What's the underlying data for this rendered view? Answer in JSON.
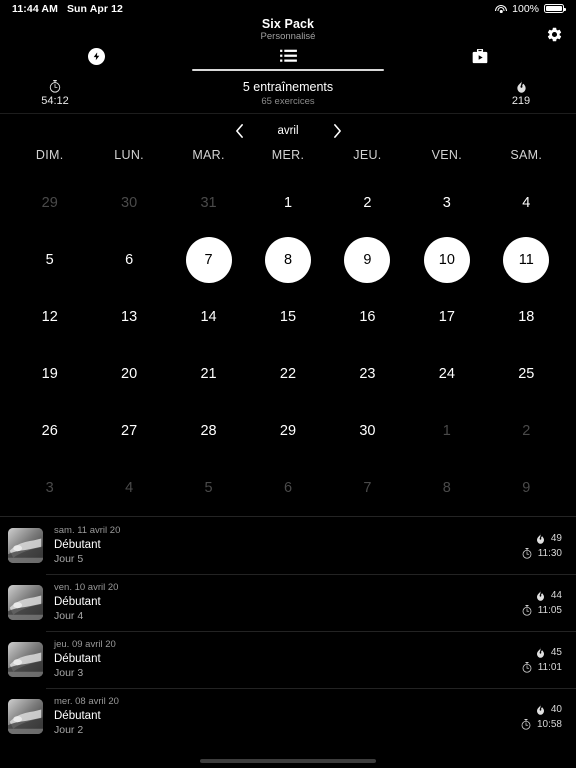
{
  "status_bar": {
    "time": "11:44 AM",
    "date": "Sun Apr 12",
    "battery_percent": "100%",
    "wifi_icon": "wifi-icon",
    "battery_icon": "battery-full-icon"
  },
  "header": {
    "title": "Six Pack",
    "subtitle": "Personnalisé",
    "settings_icon": "gear-icon"
  },
  "tabs": [
    {
      "id": "tab-workouts",
      "icon": "lightning-bolt-icon",
      "active": false
    },
    {
      "id": "tab-list",
      "icon": "list-icon",
      "active": true
    },
    {
      "id": "tab-media",
      "icon": "briefcase-play-icon",
      "active": false
    }
  ],
  "stats": {
    "duration_icon": "stopwatch-icon",
    "duration_value": "54:12",
    "main_label": "5 entraînements",
    "sub_label": "65 exercices",
    "calories_icon": "flame-icon",
    "calories_value": "219"
  },
  "calendar": {
    "prev_icon": "chevron-left-icon",
    "next_icon": "chevron-right-icon",
    "month_label": "avril",
    "day_headers": [
      "DIM.",
      "LUN.",
      "MAR.",
      "MER.",
      "JEU.",
      "VEN.",
      "SAM."
    ],
    "weeks": [
      [
        {
          "n": "29",
          "muted": true,
          "selected": false
        },
        {
          "n": "30",
          "muted": true,
          "selected": false
        },
        {
          "n": "31",
          "muted": true,
          "selected": false
        },
        {
          "n": "1",
          "muted": false,
          "selected": false
        },
        {
          "n": "2",
          "muted": false,
          "selected": false
        },
        {
          "n": "3",
          "muted": false,
          "selected": false
        },
        {
          "n": "4",
          "muted": false,
          "selected": false
        }
      ],
      [
        {
          "n": "5",
          "muted": false,
          "selected": false
        },
        {
          "n": "6",
          "muted": false,
          "selected": false
        },
        {
          "n": "7",
          "muted": false,
          "selected": true
        },
        {
          "n": "8",
          "muted": false,
          "selected": true
        },
        {
          "n": "9",
          "muted": false,
          "selected": true
        },
        {
          "n": "10",
          "muted": false,
          "selected": true
        },
        {
          "n": "11",
          "muted": false,
          "selected": true
        }
      ],
      [
        {
          "n": "12",
          "muted": false,
          "selected": false
        },
        {
          "n": "13",
          "muted": false,
          "selected": false
        },
        {
          "n": "14",
          "muted": false,
          "selected": false
        },
        {
          "n": "15",
          "muted": false,
          "selected": false
        },
        {
          "n": "16",
          "muted": false,
          "selected": false
        },
        {
          "n": "17",
          "muted": false,
          "selected": false
        },
        {
          "n": "18",
          "muted": false,
          "selected": false
        }
      ],
      [
        {
          "n": "19",
          "muted": false,
          "selected": false
        },
        {
          "n": "20",
          "muted": false,
          "selected": false
        },
        {
          "n": "21",
          "muted": false,
          "selected": false
        },
        {
          "n": "22",
          "muted": false,
          "selected": false
        },
        {
          "n": "23",
          "muted": false,
          "selected": false
        },
        {
          "n": "24",
          "muted": false,
          "selected": false
        },
        {
          "n": "25",
          "muted": false,
          "selected": false
        }
      ],
      [
        {
          "n": "26",
          "muted": false,
          "selected": false
        },
        {
          "n": "27",
          "muted": false,
          "selected": false
        },
        {
          "n": "28",
          "muted": false,
          "selected": false
        },
        {
          "n": "29",
          "muted": false,
          "selected": false
        },
        {
          "n": "30",
          "muted": false,
          "selected": false
        },
        {
          "n": "1",
          "muted": true,
          "selected": false
        },
        {
          "n": "2",
          "muted": true,
          "selected": false
        }
      ],
      [
        {
          "n": "3",
          "muted": true,
          "selected": false
        },
        {
          "n": "4",
          "muted": true,
          "selected": false
        },
        {
          "n": "5",
          "muted": true,
          "selected": false
        },
        {
          "n": "6",
          "muted": true,
          "selected": false
        },
        {
          "n": "7",
          "muted": true,
          "selected": false
        },
        {
          "n": "8",
          "muted": true,
          "selected": false
        },
        {
          "n": "9",
          "muted": true,
          "selected": false
        }
      ]
    ]
  },
  "history": {
    "calories_icon": "flame-icon",
    "duration_icon": "stopwatch-icon",
    "thumbnail_icon": "exercise-thumbnail",
    "items": [
      {
        "date": "sam. 11 avril 20",
        "name": "Débutant",
        "day": "Jour 5",
        "calories": "49",
        "duration": "11:30"
      },
      {
        "date": "ven. 10 avril 20",
        "name": "Débutant",
        "day": "Jour 4",
        "calories": "44",
        "duration": "11:05"
      },
      {
        "date": "jeu. 09 avril 20",
        "name": "Débutant",
        "day": "Jour 3",
        "calories": "45",
        "duration": "11:01"
      },
      {
        "date": "mer. 08 avril 20",
        "name": "Débutant",
        "day": "Jour 2",
        "calories": "40",
        "duration": "10:58"
      }
    ]
  },
  "colors": {
    "background": "#000000",
    "accent": "#ffffff",
    "muted_text": "#4a4a4a",
    "secondary_text": "#9a9a9a",
    "divider": "#232323"
  }
}
